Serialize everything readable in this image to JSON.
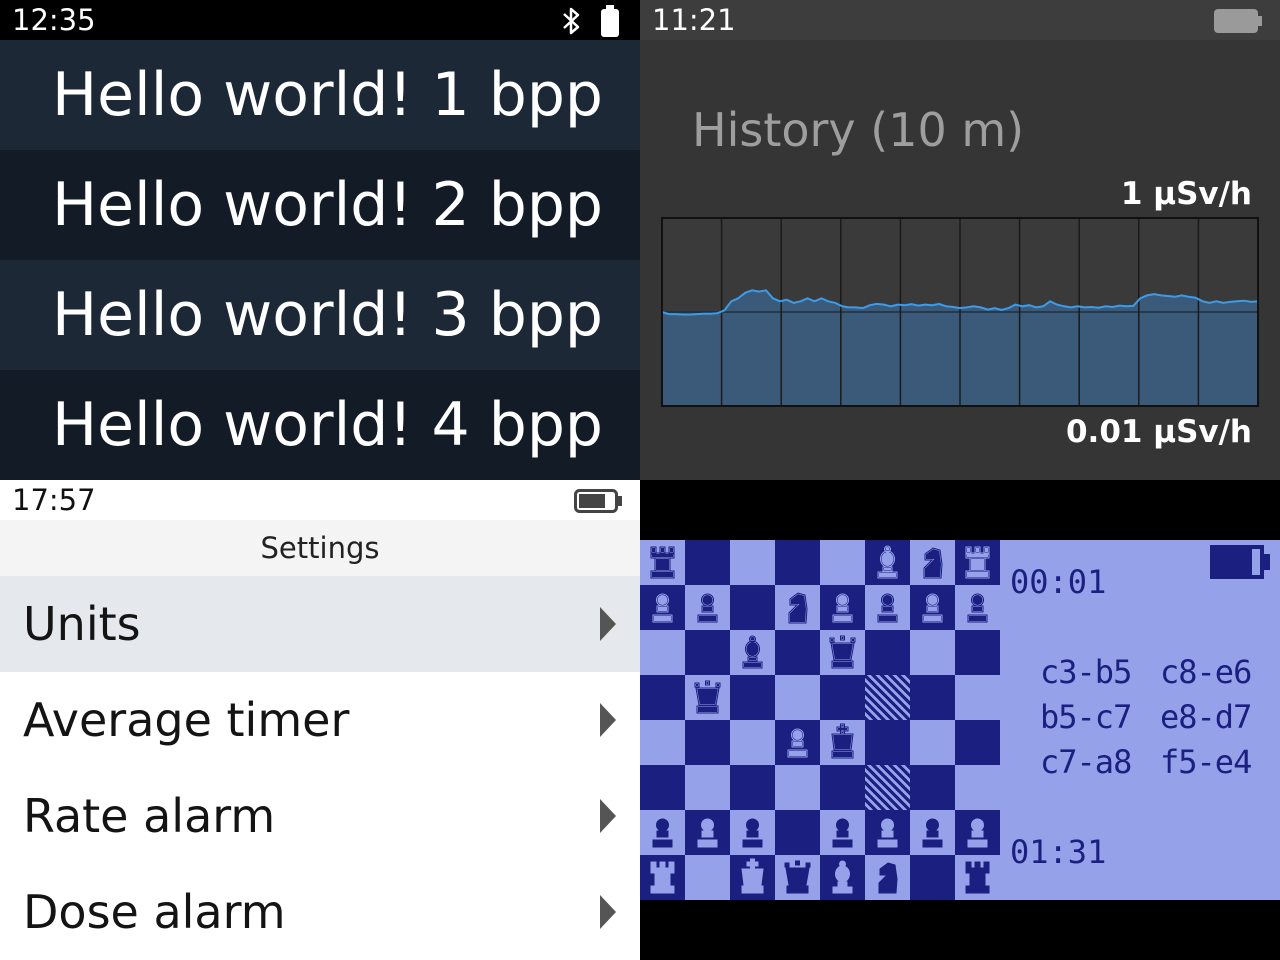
{
  "panel_list": {
    "status": {
      "time": "12:35",
      "icons": [
        "bluetooth-icon",
        "battery-icon"
      ]
    },
    "rows": [
      {
        "label": "Hello world! 1 bpp"
      },
      {
        "label": "Hello world! 2 bpp"
      },
      {
        "label": "Hello world! 3 bpp"
      },
      {
        "label": "Hello world! 4 bpp"
      }
    ]
  },
  "panel_history": {
    "status": {
      "time": "11:21",
      "icons": [
        "battery-icon"
      ]
    },
    "title": "History (10 m)",
    "y_max_label": "1 μSv/h",
    "y_min_label": "0.01 μSv/h",
    "colors": {
      "line": "#3d9be8",
      "fill": "#3b5a7a",
      "grid": "#1a1a1a"
    }
  },
  "chart_data": {
    "type": "area",
    "title": "History (10 m)",
    "y_scale": "log",
    "ylim": [
      0.01,
      1
    ],
    "y_unit": "μSv/h",
    "x_divisions": 10,
    "values": [
      0.1,
      0.095,
      0.095,
      0.094,
      0.094,
      0.095,
      0.096,
      0.096,
      0.097,
      0.104,
      0.13,
      0.14,
      0.16,
      0.17,
      0.165,
      0.17,
      0.14,
      0.13,
      0.135,
      0.125,
      0.13,
      0.14,
      0.13,
      0.14,
      0.13,
      0.125,
      0.115,
      0.112,
      0.112,
      0.11,
      0.118,
      0.122,
      0.12,
      0.115,
      0.12,
      0.118,
      0.121,
      0.117,
      0.12,
      0.118,
      0.122,
      0.115,
      0.113,
      0.11,
      0.112,
      0.115,
      0.112,
      0.106,
      0.11,
      0.105,
      0.11,
      0.12,
      0.115,
      0.118,
      0.112,
      0.115,
      0.13,
      0.12,
      0.115,
      0.112,
      0.115,
      0.112,
      0.113,
      0.111,
      0.115,
      0.113,
      0.117,
      0.115,
      0.116,
      0.14,
      0.15,
      0.155,
      0.15,
      0.148,
      0.145,
      0.15,
      0.145,
      0.142,
      0.13,
      0.125,
      0.13,
      0.125,
      0.128,
      0.13,
      0.132,
      0.128,
      0.13
    ]
  },
  "panel_settings": {
    "status": {
      "time": "17:57",
      "icons": [
        "battery-icon"
      ]
    },
    "title": "Settings",
    "items": [
      {
        "label": "Units",
        "selected": true
      },
      {
        "label": "Average timer",
        "selected": false
      },
      {
        "label": "Rate alarm",
        "selected": false
      },
      {
        "label": "Dose alarm",
        "selected": false
      }
    ]
  },
  "panel_chess": {
    "colors": {
      "dark": "#1a1f80",
      "light": "#95a2ea"
    },
    "timer_top": "00:01",
    "timer_bottom": "01:31",
    "moves": [
      [
        "c3-b5",
        "c8-e6"
      ],
      [
        "b5-c7",
        "e8-d7"
      ],
      [
        "c7-a8",
        "f5-e4"
      ]
    ],
    "board": [
      [
        "r",
        "",
        "",
        "",
        "",
        "b",
        "n",
        "r"
      ],
      [
        "p",
        "p",
        "",
        "n",
        "p",
        "p",
        "p",
        "p"
      ],
      [
        "",
        "",
        "b",
        "",
        "q",
        "",
        "",
        ""
      ],
      [
        "",
        "q",
        "",
        "",
        "",
        "H",
        "",
        ""
      ],
      [
        "",
        "",
        "",
        "p",
        "k",
        "",
        "",
        ""
      ],
      [
        "",
        "",
        "",
        "",
        "",
        "H",
        "",
        ""
      ],
      [
        "P",
        "P",
        "P",
        "",
        "P",
        "P",
        "P",
        "P"
      ],
      [
        "R",
        "",
        "K",
        "Q",
        "B",
        "N",
        "",
        "R"
      ]
    ]
  }
}
